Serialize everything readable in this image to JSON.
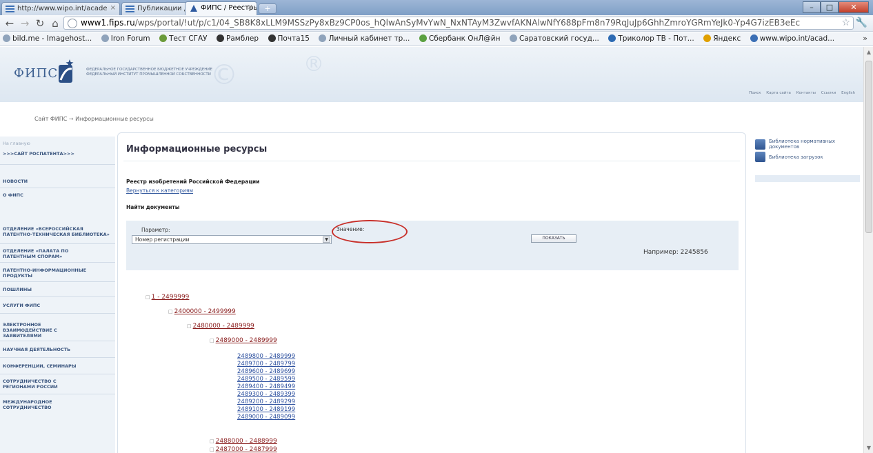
{
  "browser": {
    "tabs": [
      {
        "title": "http://www.wipo.int/acade",
        "active": false
      },
      {
        "title": "Публикации для молодеж",
        "active": false
      },
      {
        "title": "ФИПС / Реестры",
        "active": true
      }
    ],
    "url_host": "www1.fips.ru",
    "url_rest": "/wps/portal/!ut/p/c1/04_SB8K8xLLM9MSSzPy8xBz9CP0os_hQlwAnSyMvYwN_NxNTAyM3ZwvfAKNAlwNfY688pFm8n79RqJuJp6GhhZmroYGRmYeJk0-Yp4G7izEB3eEc"
  },
  "bookmarks": [
    "bild.me - Imagehost...",
    "Iron Forum",
    "Тест СГАУ",
    "Рамблер",
    "Почта15",
    "Личный кабинет тр...",
    "Сбербанк ОнЛ@йн",
    "Саратовский госуд...",
    "Триколор ТВ - Пот...",
    "Яндекс",
    "www.wipo.int/acad..."
  ],
  "site": {
    "logo": "ФИПС",
    "org_line1": "ФЕДЕРАЛЬНОЕ ГОСУДАРСТВЕННОЕ БЮДЖЕТНОЕ УЧРЕЖДЕНИЕ",
    "org_line2": "ФЕДЕРАЛЬНЫЙ ИНСТИТУТ ПРОМЫШЛЕННОЙ СОБСТВЕННОСТИ",
    "top_links": [
      "Поиск",
      "Карта сайта",
      "Контакты",
      "Ссылки",
      "English"
    ],
    "breadcrumb_home": "Сайт ФИПС",
    "breadcrumb_arrow": "→",
    "breadcrumb_current": "Информационные ресурсы"
  },
  "left_nav": {
    "faint_top": "На главную",
    "items": [
      ">>>САЙТ РОСПАТЕНТА>>>",
      "НОВОСТИ",
      "О ФИПС",
      "ОТДЕЛЕНИЕ «ВСЕРОССИЙСКАЯ ПАТЕНТНО-ТЕХНИЧЕСКАЯ БИБЛИОТЕКА»",
      "ОТДЕЛЕНИЕ «ПАЛАТА ПО ПАТЕНТНЫМ СПОРАМ»",
      "ПАТЕНТНО-ИНФОРМАЦИОННЫЕ ПРОДУКТЫ",
      "ПОШЛИНЫ",
      "УСЛУГИ ФИПС",
      "ЭЛЕКТРОННОЕ ВЗАИМОДЕЙСТВИЕ С ЗАЯВИТЕЛЯМИ",
      "НАУЧНАЯ ДЕЯТЕЛЬНОСТЬ",
      "КОНФЕРЕНЦИИ, СЕМИНАРЫ",
      "СОТРУДНИЧЕСТВО С РЕГИОНАМИ РОССИИ",
      "МЕЖДУНАРОДНОЕ СОТРУДНИЧЕСТВО"
    ]
  },
  "content": {
    "title": "Информационные ресурсы",
    "registry_title": "Реестр изобретений Российской Федерации",
    "back_link": "Вернуться к категориям",
    "find_title": "Найти документы",
    "param_label": "Параметр:",
    "param_value": "Номер регистрации",
    "value_label": "Значение:",
    "value_input": "",
    "show_button": "ПОКАЗАТЬ",
    "example": "Например: 2245856"
  },
  "tree": {
    "level1": "1 - 2499999",
    "level2": "2400000 - 2499999",
    "level3": "2480000 - 2489999",
    "level4": "2489000 - 2489999",
    "leaves": [
      "2489800 - 2489999",
      "2489700 - 2489799",
      "2489600 - 2489699",
      "2489500 - 2489599",
      "2489400 - 2489499",
      "2489300 - 2489399",
      "2489200 - 2489299",
      "2489100 - 2489199",
      "2489000 - 2489099"
    ],
    "sibling1": "2488000 - 2488999",
    "sibling2": "2487000 - 2487999"
  },
  "right_side": {
    "item1": "Библиотека нормативных документов",
    "item2": "Библиотека загрузок"
  }
}
